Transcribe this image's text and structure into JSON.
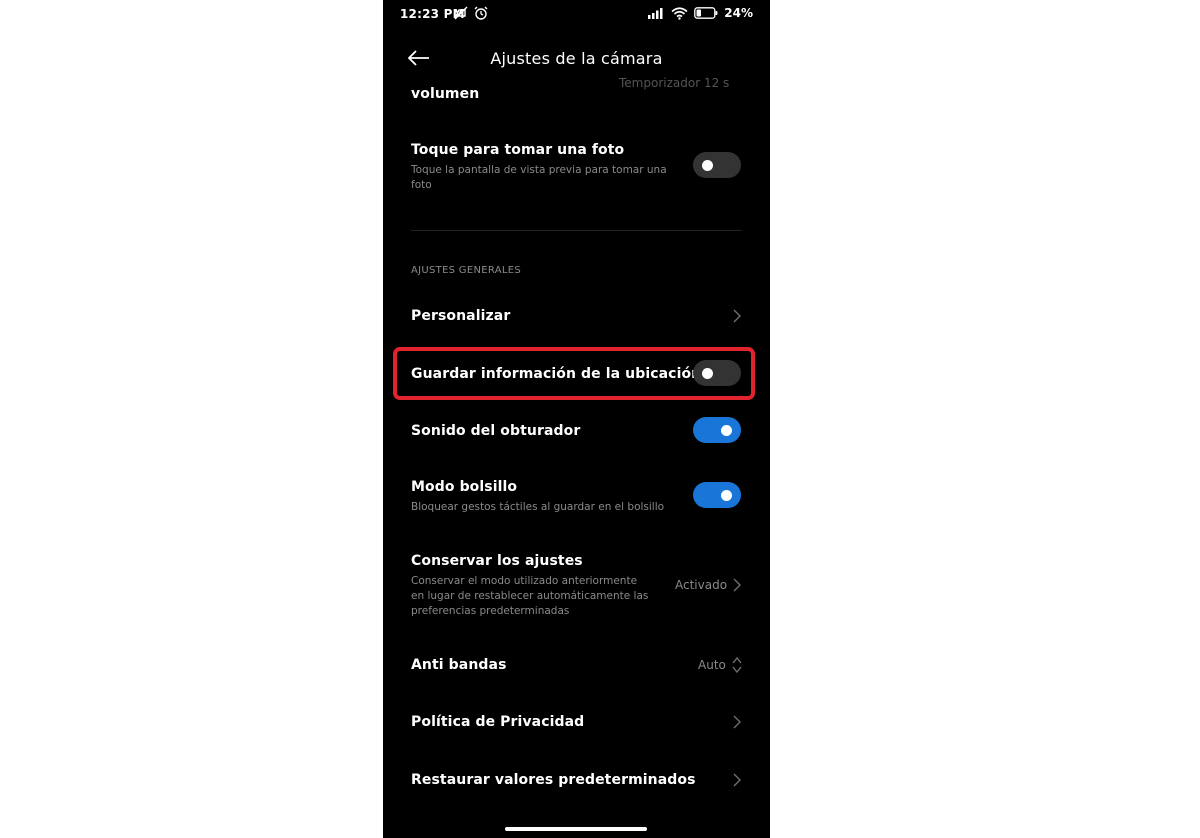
{
  "status_bar": {
    "time": "12:23 PM",
    "battery": "24",
    "icons": [
      "mute-icon",
      "alarm-icon",
      "signal-icon",
      "wifi-icon",
      "battery-icon"
    ]
  },
  "header": {
    "title": "Ajustes de la cámara",
    "back_icon": "arrow-left-icon"
  },
  "partial_top": {
    "title": "volumen",
    "value": "Temporizador 12 s"
  },
  "tap_photo": {
    "title": "Toque para tomar una foto",
    "subtitle_line1": "Toque la pantalla de vista previa para tomar una",
    "subtitle_line2": "foto",
    "enabled": false
  },
  "section_general": "AJUSTES GENERALES",
  "settings": {
    "personalizar": {
      "title": "Personalizar"
    },
    "location": {
      "title": "Guardar información de la ubicación",
      "enabled": false
    },
    "shutter": {
      "title": "Sonido del obturador",
      "enabled": true
    },
    "pocket": {
      "title": "Modo bolsillo",
      "subtitle": "Bloquear gestos táctiles al guardar en el bolsillo",
      "enabled": true
    },
    "preserve": {
      "title": "Conservar los ajustes",
      "subtitle_line1": "Conservar el modo utilizado anteriormente",
      "subtitle_line2": "en lugar de restablecer automáticamente las",
      "subtitle_line3": "preferencias predeterminadas",
      "value": "Activado"
    },
    "antibanding": {
      "title": "Anti bandas",
      "value": "Auto"
    },
    "privacy": {
      "title": "Política de Privacidad"
    },
    "restore": {
      "title": "Restaurar valores predeterminados"
    }
  },
  "colors": {
    "background": "#000000",
    "toggle_on": "#1976d8",
    "toggle_off": "#333333",
    "highlight": "#e0232d"
  }
}
